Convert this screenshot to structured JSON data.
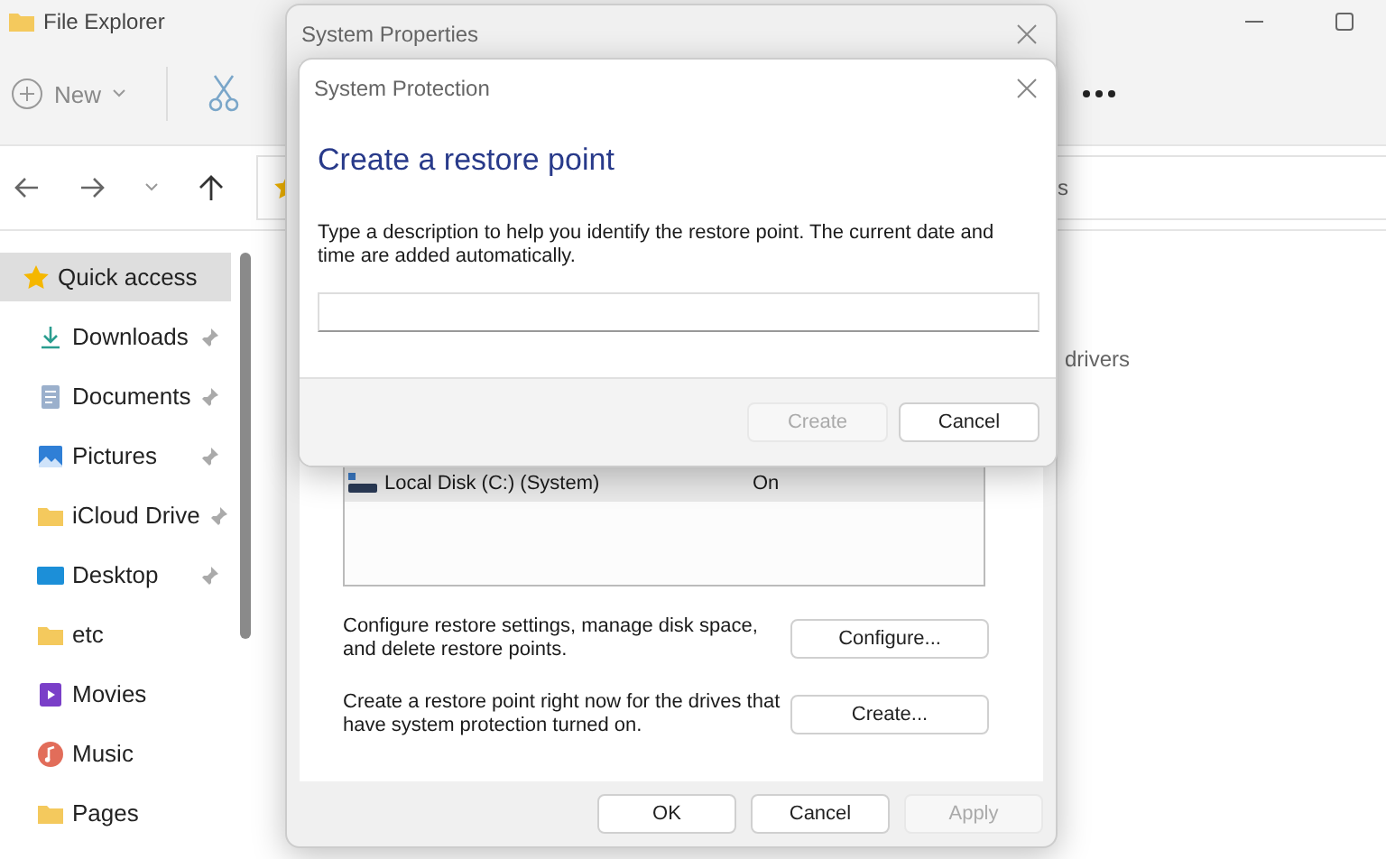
{
  "explorer": {
    "title": "File Explorer",
    "new_label": "New",
    "address_tail": "s",
    "nav": [
      {
        "label": "Quick access",
        "kind": "star",
        "selected": true,
        "pinned": false
      },
      {
        "label": "Downloads",
        "kind": "download",
        "selected": false,
        "pinned": true
      },
      {
        "label": "Documents",
        "kind": "document",
        "selected": false,
        "pinned": true
      },
      {
        "label": "Pictures",
        "kind": "picture",
        "selected": false,
        "pinned": true
      },
      {
        "label": "iCloud Drive",
        "kind": "folder",
        "selected": false,
        "pinned": true
      },
      {
        "label": "Desktop",
        "kind": "desktop",
        "selected": false,
        "pinned": true
      },
      {
        "label": "etc",
        "kind": "folder",
        "selected": false,
        "pinned": false
      },
      {
        "label": "Movies",
        "kind": "video",
        "selected": false,
        "pinned": false
      },
      {
        "label": "Music",
        "kind": "music",
        "selected": false,
        "pinned": false
      },
      {
        "label": "Pages",
        "kind": "folder",
        "selected": false,
        "pinned": false
      }
    ],
    "content_text": "drivers"
  },
  "system_properties": {
    "title": "System Properties",
    "drives": [
      {
        "name": "Local Disk (C:) (System)",
        "protection": "On",
        "selected": true
      }
    ],
    "actions": [
      {
        "text": "Configure restore settings, manage disk space, and delete restore points.",
        "button": "Configure..."
      },
      {
        "text": "Create a restore point right now for the drives that have system protection turned on.",
        "button": "Create..."
      }
    ],
    "buttons": [
      {
        "label": "OK",
        "disabled": false
      },
      {
        "label": "Cancel",
        "disabled": false
      },
      {
        "label": "Apply",
        "disabled": true
      }
    ]
  },
  "protection_dialog": {
    "title": "System Protection",
    "heading": "Create a restore point",
    "description": "Type a description to help you identify the restore point. The current date and time are added automatically.",
    "buttons": [
      {
        "label": "Create",
        "disabled": true
      },
      {
        "label": "Cancel",
        "disabled": false
      }
    ]
  }
}
